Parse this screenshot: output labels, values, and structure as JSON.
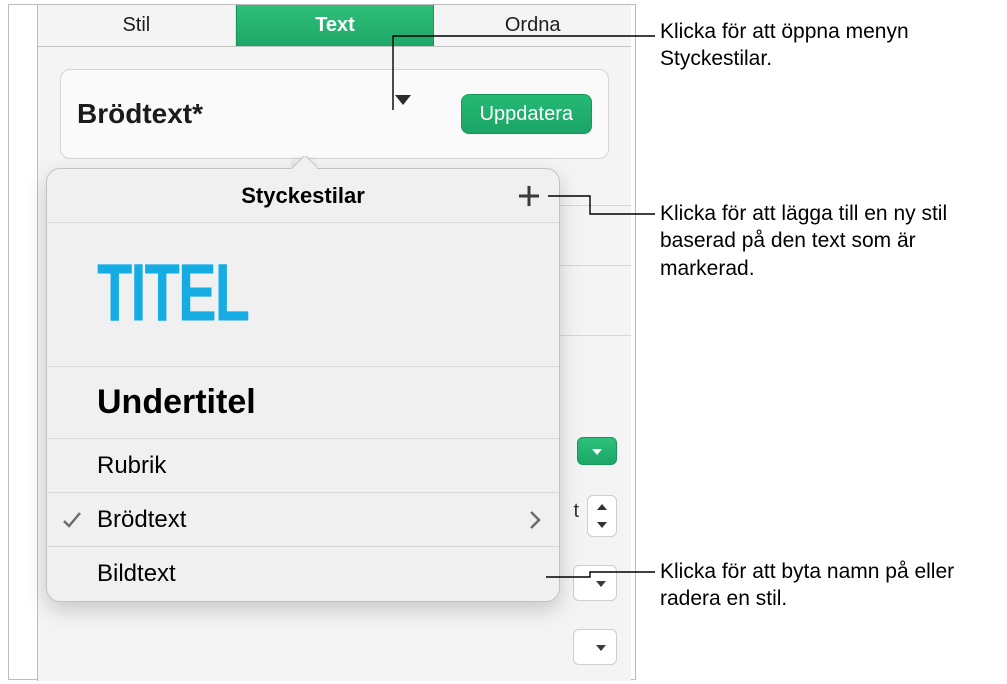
{
  "tabs": {
    "stil": "Stil",
    "text": "Text",
    "ordna": "Ordna"
  },
  "style_well": {
    "name": "Brödtext*",
    "update_label": "Uppdatera"
  },
  "popover": {
    "title": "Styckestilar",
    "items": {
      "titel": "TITEL",
      "undertitel": "Undertitel",
      "rubrik": "Rubrik",
      "brodtext": "Brödtext",
      "bildtext": "Bildtext"
    }
  },
  "bg": {
    "t": "t"
  },
  "callouts": {
    "open_menu": "Klicka för att öppna menyn Styckestilar.",
    "add_style": "Klicka för att lägga till en ny stil baserad på den text som är markerad.",
    "rename_delete": "Klicka för att byta namn på eller radera en stil."
  }
}
